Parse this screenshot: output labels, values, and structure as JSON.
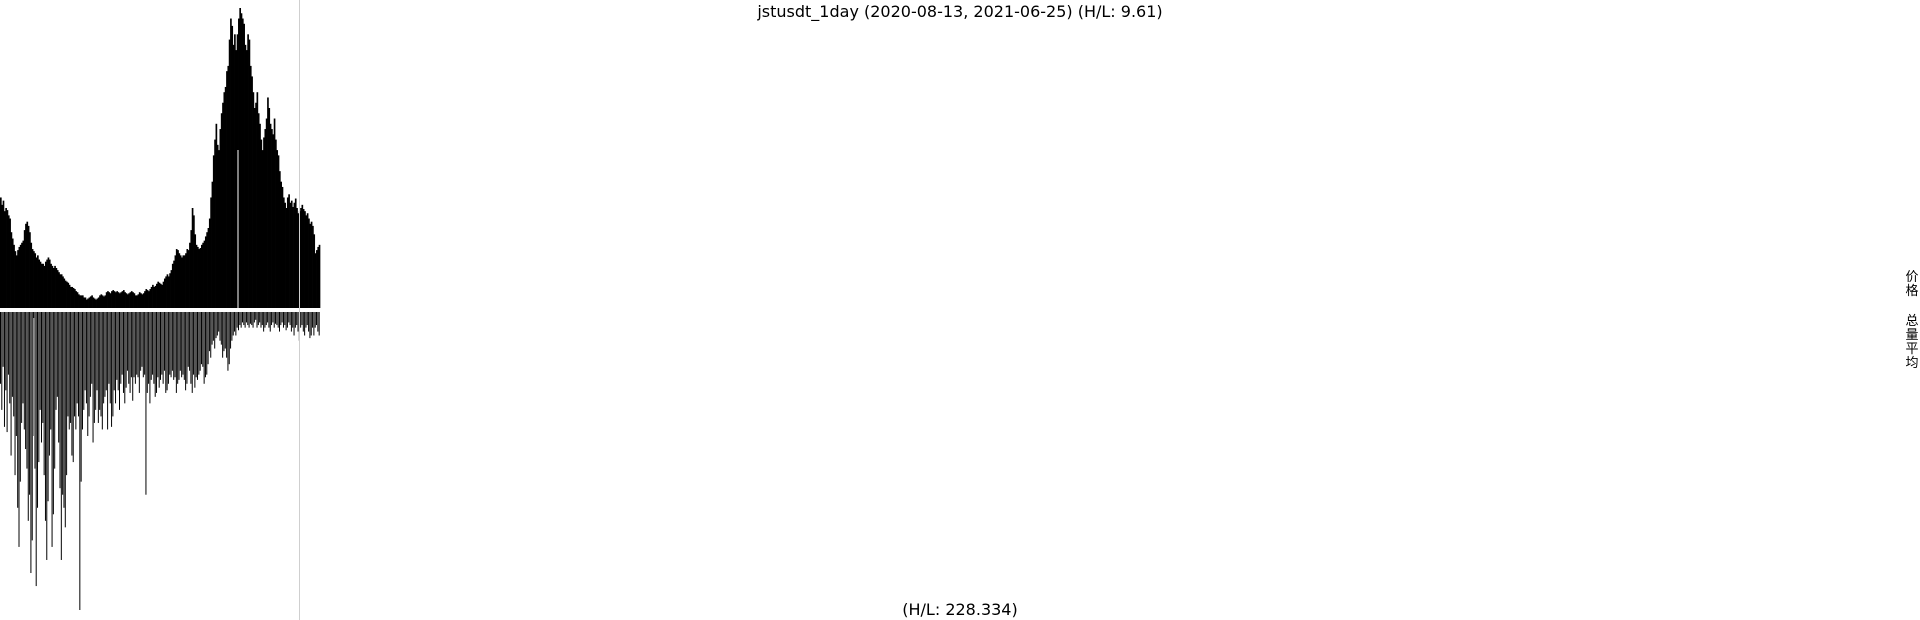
{
  "chart_data": {
    "type": "bar",
    "title": "jstusdt_1day (2020-08-13, 2021-06-25) (H/L: 9.61)",
    "subtitle": "(H/L: 228.334)",
    "side_labels": [
      "价格",
      "总量平均"
    ],
    "grid": false,
    "legend": "none",
    "series": [
      {
        "values": [
          1.05,
          0.98,
          1.02,
          0.92,
          0.95,
          0.93,
          0.88,
          0.85,
          0.72,
          0.66,
          0.6,
          0.54,
          0.5,
          0.55,
          0.58,
          0.6,
          0.62,
          0.64,
          0.74,
          0.8,
          0.82,
          0.78,
          0.72,
          0.62,
          0.56,
          0.54,
          0.52,
          0.48,
          0.5,
          0.46,
          0.44,
          0.42,
          0.42,
          0.4,
          0.44,
          0.46,
          0.48,
          0.46,
          0.42,
          0.4,
          0.38,
          0.4,
          0.38,
          0.36,
          0.34,
          0.32,
          0.32,
          0.3,
          0.28,
          0.26,
          0.25,
          0.24,
          0.22,
          0.2,
          0.2,
          0.19,
          0.18,
          0.16,
          0.15,
          0.13,
          0.12,
          0.12,
          0.12,
          0.1,
          0.1,
          0.08,
          0.09,
          0.1,
          0.11,
          0.12,
          0.1,
          0.09,
          0.08,
          0.09,
          0.1,
          0.12,
          0.13,
          0.12,
          0.11,
          0.12,
          0.15,
          0.16,
          0.15,
          0.14,
          0.16,
          0.17,
          0.16,
          0.15,
          0.16,
          0.15,
          0.14,
          0.15,
          0.16,
          0.17,
          0.15,
          0.14,
          0.13,
          0.14,
          0.15,
          0.16,
          0.15,
          0.14,
          0.12,
          0.12,
          0.13,
          0.15,
          0.14,
          0.13,
          0.14,
          0.16,
          0.18,
          0.17,
          0.16,
          0.18,
          0.2,
          0.22,
          0.2,
          0.21,
          0.23,
          0.25,
          0.24,
          0.23,
          0.22,
          0.25,
          0.28,
          0.3,
          0.32,
          0.3,
          0.33,
          0.36,
          0.42,
          0.45,
          0.5,
          0.56,
          0.55,
          0.52,
          0.5,
          0.48,
          0.5,
          0.5,
          0.52,
          0.56,
          0.55,
          0.62,
          0.74,
          0.95,
          0.88,
          0.7,
          0.6,
          0.58,
          0.56,
          0.57,
          0.6,
          0.62,
          0.64,
          0.68,
          0.72,
          0.76,
          0.85,
          1.05,
          1.2,
          1.45,
          1.6,
          1.75,
          1.55,
          1.5,
          1.7,
          1.85,
          1.95,
          2.05,
          2.1,
          2.25,
          2.3,
          2.55,
          2.75,
          2.68,
          2.5,
          2.6,
          2.45,
          2.6,
          2.75,
          2.85,
          2.8,
          2.75,
          2.7,
          2.5,
          2.45,
          2.6,
          2.55,
          2.3,
          2.2,
          2.05,
          1.9,
          1.95,
          2.05,
          1.85,
          1.75,
          1.6,
          1.5,
          1.62,
          1.7,
          1.8,
          2.0,
          1.9,
          1.75,
          1.7,
          1.65,
          1.8,
          1.6,
          1.5,
          1.45,
          1.3,
          1.2,
          1.15,
          1.05,
          1.0,
          0.95,
          1.05,
          1.08,
          1.0,
          1.02,
          0.96,
          1.0,
          1.04,
          0.95,
          0.9,
          0.92,
          0.95,
          0.98,
          0.94,
          0.92,
          0.88,
          0.9,
          0.85,
          0.8,
          0.82,
          0.78,
          0.7,
          0.52,
          0.55,
          0.58,
          0.6
        ]
      },
      {
        "values": [
          55,
          75,
          42,
          88,
          60,
          92,
          48,
          70,
          110,
          65,
          80,
          125,
          95,
          150,
          180,
          130,
          85,
          70,
          90,
          105,
          120,
          160,
          140,
          200,
          175,
          95,
          120,
          210,
          150,
          115,
          75,
          100,
          85,
          125,
          160,
          190,
          145,
          110,
          90,
          180,
          155,
          120,
          75,
          65,
          100,
          135,
          190,
          140,
          150,
          165,
          125,
          80,
          90,
          85,
          110,
          115,
          80,
          90,
          70,
          80,
          228.334,
          130,
          90,
          75,
          60,
          70,
          95,
          80,
          65,
          55,
          100,
          85,
          75,
          60,
          85,
          75,
          80,
          90,
          70,
          65,
          60,
          90,
          55,
          70,
          88,
          80,
          60,
          70,
          52,
          60,
          75,
          55,
          48,
          62,
          70,
          58,
          45,
          55,
          62,
          50,
          68,
          50,
          55,
          48,
          50,
          62,
          45,
          42,
          50,
          48,
          140,
          62,
          55,
          70,
          52,
          48,
          55,
          65,
          62,
          50,
          58,
          52,
          48,
          55,
          45,
          62,
          60,
          55,
          48,
          50,
          45,
          52,
          50,
          62,
          55,
          52,
          45,
          50,
          48,
          52,
          60,
          55,
          42,
          45,
          55,
          62,
          48,
          58,
          50,
          52,
          48,
          45,
          40,
          42,
          55,
          50,
          48,
          40,
          30,
          35,
          25,
          22,
          28,
          20,
          18,
          15,
          22,
          25,
          35,
          30,
          28,
          35,
          45,
          40,
          28,
          22,
          18,
          15,
          18,
          12,
          14,
          10,
          12,
          8,
          10,
          12,
          8,
          10,
          12,
          9,
          10,
          12,
          8,
          6,
          12,
          10,
          8,
          12,
          10,
          15,
          12,
          10,
          8,
          12,
          15,
          10,
          8,
          12,
          9,
          10,
          12,
          15,
          10,
          8,
          12,
          10,
          14,
          12,
          8,
          10,
          15,
          12,
          18,
          12,
          10,
          15,
          22,
          12,
          10,
          15,
          18,
          12,
          10,
          15,
          20,
          18,
          12,
          18,
          12,
          10,
          15,
          18,
          20,
          15,
          22,
          18,
          12,
          25,
          30,
          20,
          28,
          25,
          35,
          30,
          38,
          32,
          30,
          28,
          38,
          40,
          35,
          30,
          22,
          20,
          18
        ]
      }
    ]
  }
}
